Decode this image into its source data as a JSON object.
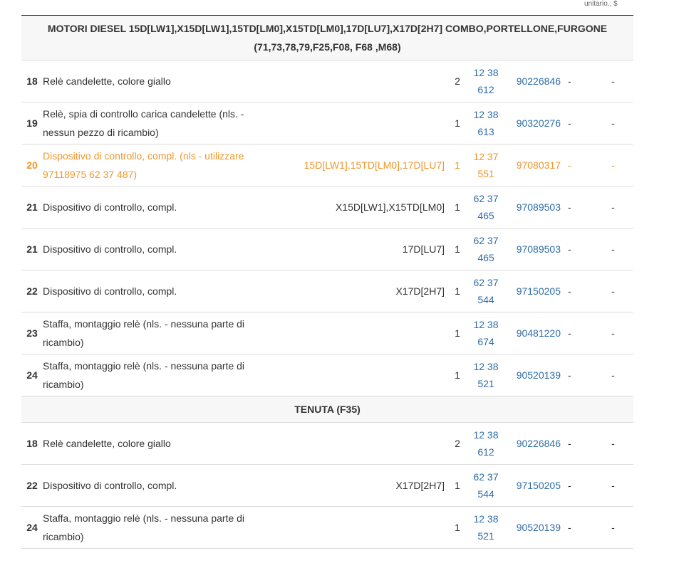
{
  "header_note": "unitario., $",
  "sections": [
    {
      "title": "MOTORI DIESEL 15D[LW1],X15D[LW1],15TD[LM0],X15TD[LM0],17D[LU7],X17D[2H7] COMBO,PORTELLONE,FURGONE (71,73,78,79,F25,F08, F68 ,M68)",
      "rows": [
        {
          "num": "18",
          "desc": "Relè candelette, colore giallo",
          "engine": "",
          "qty": "2",
          "catalog": "12 38 612",
          "part": "90226846",
          "d1": "-",
          "d2": "-",
          "highlight": false
        },
        {
          "num": "19",
          "desc": "Relè, spia di controllo carica candelette (nls. - nessun pezzo di ricambio)",
          "engine": "",
          "qty": "1",
          "catalog": "12 38 613",
          "part": "90320276",
          "d1": "-",
          "d2": "-",
          "highlight": false
        },
        {
          "num": "20",
          "desc": "Dispositivo di controllo, compl. (nls - utilizzare 97118975 62 37 487)",
          "engine": "15D[LW1],15TD[LM0],17D[LU7]",
          "qty": "1",
          "catalog": "12 37 551",
          "part": "97080317",
          "d1": "-",
          "d2": "-",
          "highlight": true
        },
        {
          "num": "21",
          "desc": "Dispositivo di controllo, compl.",
          "engine": "X15D[LW1],X15TD[LM0]",
          "qty": "1",
          "catalog": "62 37 465",
          "part": "97089503",
          "d1": "-",
          "d2": "-",
          "highlight": false
        },
        {
          "num": "21",
          "desc": "Dispositivo di controllo, compl.",
          "engine": "17D[LU7]",
          "qty": "1",
          "catalog": "62 37 465",
          "part": "97089503",
          "d1": "-",
          "d2": "-",
          "highlight": false
        },
        {
          "num": "22",
          "desc": "Dispositivo di controllo, compl.",
          "engine": "X17D[2H7]",
          "qty": "1",
          "catalog": "62 37 544",
          "part": "97150205",
          "d1": "-",
          "d2": "-",
          "highlight": false
        },
        {
          "num": "23",
          "desc": "Staffa, montaggio relè (nls. - nessuna parte di ricambio)",
          "engine": "",
          "qty": "1",
          "catalog": "12 38 674",
          "part": "90481220",
          "d1": "-",
          "d2": "-",
          "highlight": false
        },
        {
          "num": "24",
          "desc": "Staffa, montaggio relè (nls. - nessuna parte di ricambio)",
          "engine": "",
          "qty": "1",
          "catalog": "12 38 521",
          "part": "90520139",
          "d1": "-",
          "d2": "-",
          "highlight": false
        }
      ]
    },
    {
      "title": "TENUTA (F35)",
      "rows": [
        {
          "num": "18",
          "desc": "Relè candelette, colore giallo",
          "engine": "",
          "qty": "2",
          "catalog": "12 38 612",
          "part": "90226846",
          "d1": "-",
          "d2": "-",
          "highlight": false
        },
        {
          "num": "22",
          "desc": "Dispositivo di controllo, compl.",
          "engine": "X17D[2H7]",
          "qty": "1",
          "catalog": "62 37 544",
          "part": "97150205",
          "d1": "-",
          "d2": "-",
          "highlight": false
        },
        {
          "num": "24",
          "desc": "Staffa, montaggio relè (nls. - nessuna parte di ricambio)",
          "engine": "",
          "qty": "1",
          "catalog": "12 38 521",
          "part": "90520139",
          "d1": "-",
          "d2": "-",
          "highlight": false
        }
      ]
    }
  ],
  "colors": {
    "link": "#2f6da8",
    "highlight": "#f0962c",
    "section_bg": "#f7f7f7"
  }
}
